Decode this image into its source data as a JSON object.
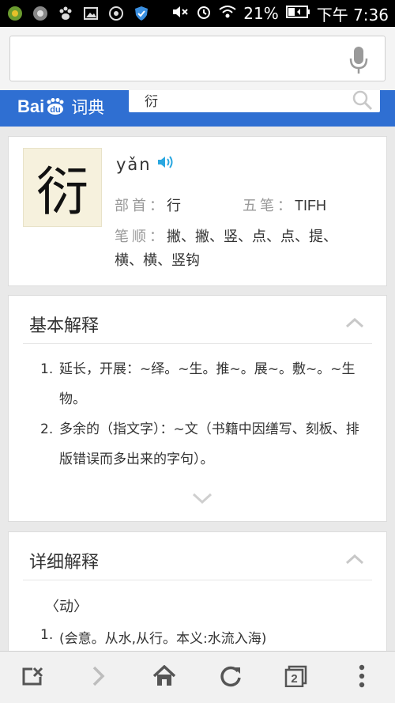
{
  "status_bar": {
    "battery": "21%",
    "time": "下午 7:36"
  },
  "browser": {
    "url_value": ""
  },
  "header": {
    "logo_text_bai": "Bai",
    "logo_text_du": "du",
    "logo_text_cidian": "词典",
    "search_query": "衍"
  },
  "entry": {
    "character": "衍",
    "pinyin": "yǎn",
    "radical_label": "部首：",
    "radical": "行",
    "wubi_label": "五笔：",
    "wubi": "TIFH",
    "strokes_label": "笔顺：",
    "strokes_line1": "撇、撇、竖、点、点、提、",
    "strokes_line2": "横、横、竖钩"
  },
  "basic": {
    "title": "基本解释",
    "items": [
      {
        "num": "1.",
        "text": "延长，开展：~绎。~生。推~。展~。敷~。~生物。"
      },
      {
        "num": "2.",
        "text": "多余的（指文字）：~文（书籍中因缮写、刻板、排版错误而多出来的字句）。"
      }
    ]
  },
  "detailed": {
    "title": "详细解释",
    "pos": "〈动〉",
    "item1_num": "1.",
    "item1_text": "(会意。从水,从行。本义:水流入海)"
  },
  "colors": {
    "baidu_blue": "#2f6fd2",
    "char_bg": "#f6f1dd",
    "speaker": "#2aa7e0"
  }
}
